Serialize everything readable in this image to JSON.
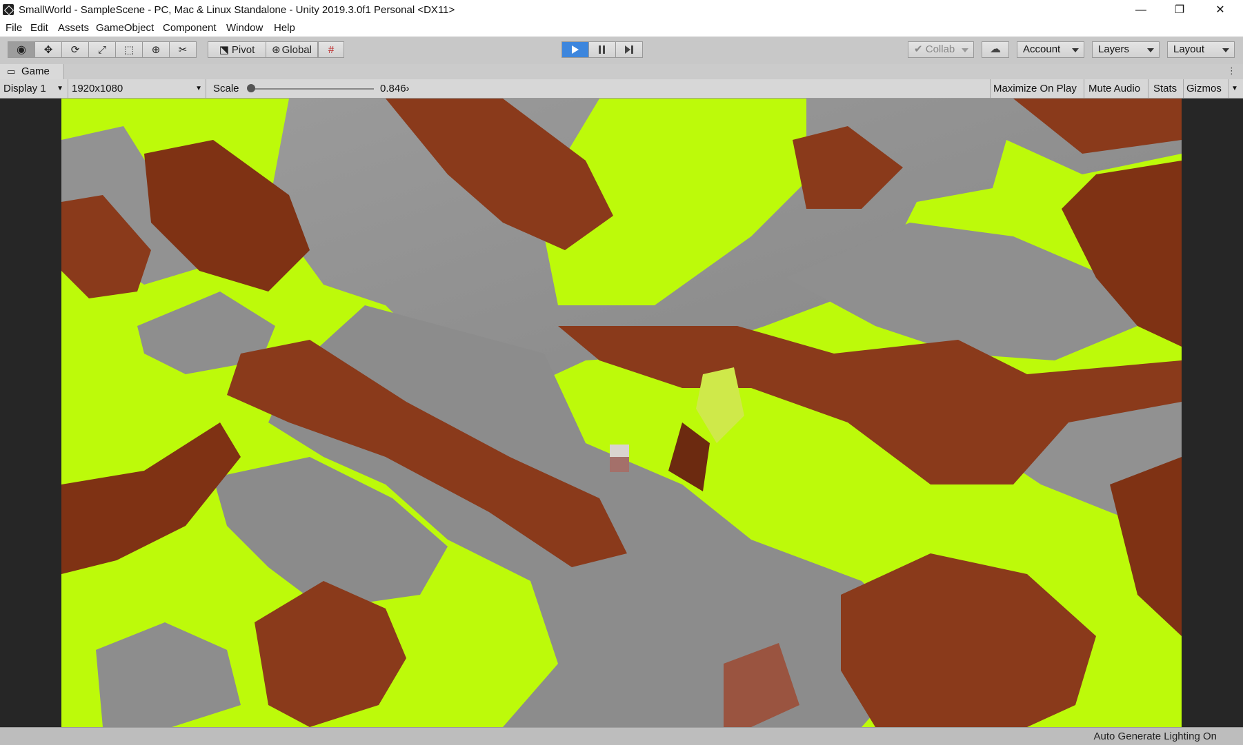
{
  "window": {
    "title": "SmallWorld - SampleScene - PC, Mac & Linux Standalone - Unity 2019.3.0f1 Personal <DX11>",
    "controls": {
      "minimize": "—",
      "restore": "❐",
      "close": "✕"
    }
  },
  "menu": [
    "File",
    "Edit",
    "Assets",
    "GameObject",
    "Component",
    "Window",
    "Help"
  ],
  "toolbar": {
    "tools": [
      {
        "name": "view-tool",
        "icon": "eye-icon",
        "glyph": "👁"
      },
      {
        "name": "move-tool",
        "icon": "move-arrows-icon",
        "glyph": "✥"
      },
      {
        "name": "rotate-tool",
        "icon": "rotate-icon",
        "glyph": "⟳"
      },
      {
        "name": "scale-tool",
        "icon": "scale-icon",
        "glyph": "⤢"
      },
      {
        "name": "rect-tool",
        "icon": "rect-transform-icon",
        "glyph": "⬚"
      },
      {
        "name": "transform-tool",
        "icon": "transform-icon",
        "glyph": "⊕"
      },
      {
        "name": "custom-tool",
        "icon": "tools-icon",
        "glyph": "✂"
      }
    ],
    "pivot_label": "Pivot",
    "global_label": "Global",
    "snap_icon": "grid-snap-icon",
    "play": {
      "play_icon": "play-icon",
      "pause_icon": "pause-icon",
      "step_icon": "step-icon"
    },
    "collab_label": "Collab",
    "cloud_icon": "cloud-icon",
    "account_label": "Account",
    "layers_label": "Layers",
    "layout_label": "Layout"
  },
  "game_tab": {
    "label": "Game",
    "icon": "gamepad-icon"
  },
  "game_bar": {
    "display": "Display 1",
    "resolution": "1920x1080",
    "scale_label": "Scale",
    "scale_value": "0.846›",
    "scale_fraction": 0.0,
    "maximize_label": "Maximize On Play",
    "mute_label": "Mute Audio",
    "stats_label": "Stats",
    "gizmos_label": "Gizmos"
  },
  "status": {
    "text": "Auto Generate Lighting On"
  },
  "colors": {
    "lime": "#bdfa0a",
    "brown": "#8a3a1b",
    "gray": "#8f8f8f",
    "play_blue": "#3d86dd"
  }
}
